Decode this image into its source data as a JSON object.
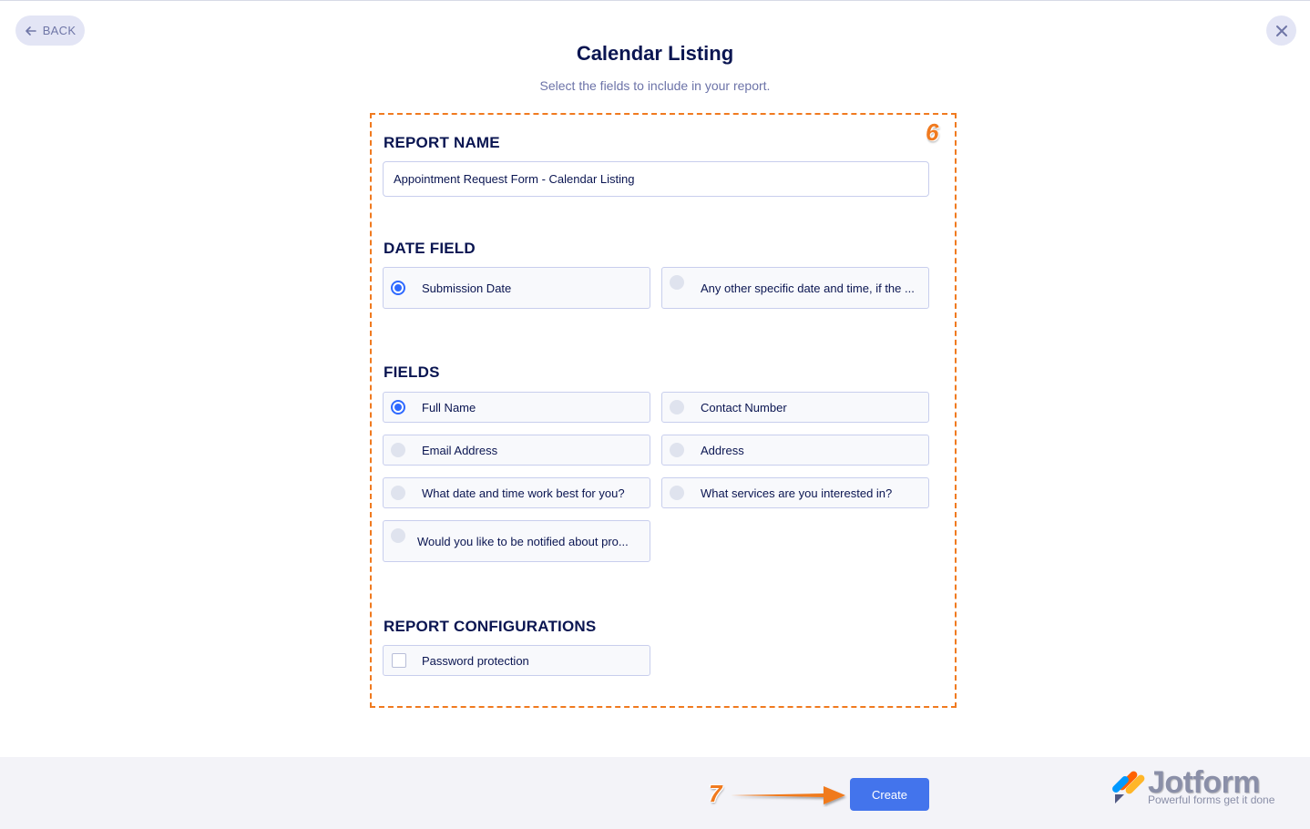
{
  "header": {
    "back_label": "BACK",
    "title": "Calendar Listing",
    "subtitle": "Select the fields to include in your report."
  },
  "annotations": {
    "step_box": "6",
    "step_create": "7",
    "accent_color": "#f07a1f"
  },
  "report_name": {
    "label": "REPORT NAME",
    "value": "Appointment Request Form - Calendar Listing"
  },
  "date_field": {
    "label": "DATE FIELD",
    "options": [
      {
        "label": "Submission Date",
        "checked": true
      },
      {
        "label": "Any other specific date and time, if the ...",
        "checked": false
      }
    ]
  },
  "fields": {
    "label": "FIELDS",
    "options": [
      {
        "label": "Full Name",
        "checked": true
      },
      {
        "label": "Contact Number",
        "checked": false
      },
      {
        "label": "Email Address",
        "checked": false
      },
      {
        "label": "Address",
        "checked": false
      },
      {
        "label": "What date and time work best for you?",
        "checked": false
      },
      {
        "label": "What services are you interested in?",
        "checked": false
      },
      {
        "label": "Would you like to be notified about pro...",
        "checked": false
      }
    ]
  },
  "configurations": {
    "label": "REPORT CONFIGURATIONS",
    "options": [
      {
        "label": "Password protection",
        "checked": false
      }
    ]
  },
  "footer": {
    "create_label": "Create",
    "brand_name": "Jotform",
    "brand_tagline": "Powerful forms get it done",
    "primary_color": "#4374ec"
  }
}
